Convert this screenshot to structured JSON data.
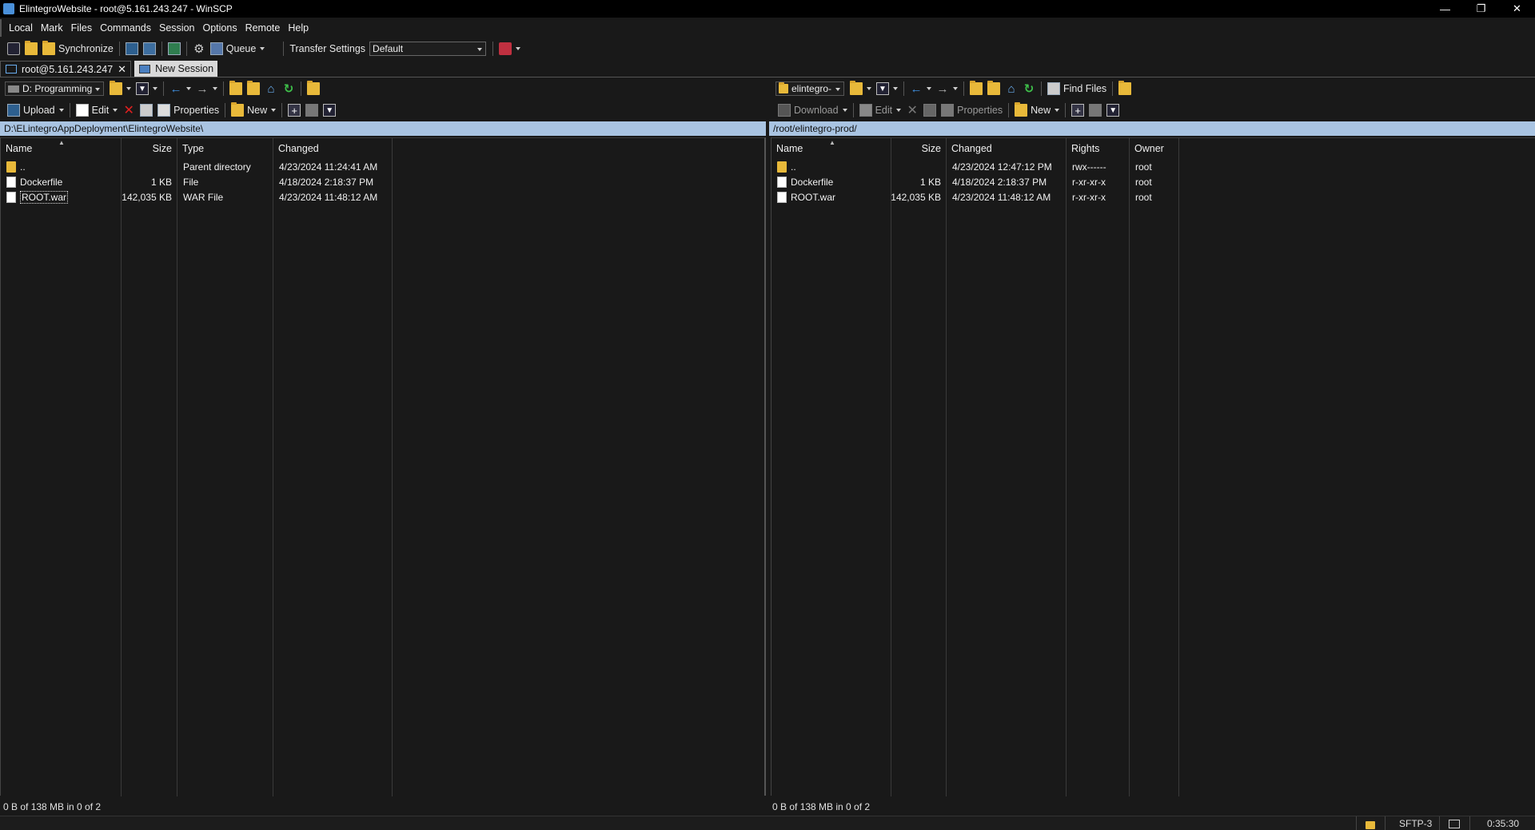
{
  "window": {
    "title": "ElintegroWebsite - root@5.161.243.247 - WinSCP",
    "minimize": "—",
    "restore": "❐",
    "close": "✕"
  },
  "menu": [
    "Local",
    "Mark",
    "Files",
    "Commands",
    "Session",
    "Options",
    "Remote",
    "Help"
  ],
  "toolbar": {
    "synchronize": "Synchronize",
    "queue": "Queue",
    "transfer_settings_label": "Transfer Settings",
    "transfer_settings_value": "Default"
  },
  "tabs": [
    {
      "label": "root@5.161.243.247",
      "close": "✕"
    },
    {
      "label": "New Session"
    }
  ],
  "local": {
    "drive": "D: Programming",
    "upload": "Upload",
    "edit": "Edit",
    "properties": "Properties",
    "new": "New",
    "path": "D:\\ELintegroAppDeployment\\ElintegroWebsite\\",
    "columns": {
      "name": "Name",
      "size": "Size",
      "type": "Type",
      "changed": "Changed"
    },
    "files": [
      {
        "name": "..",
        "size": "",
        "type": "Parent directory",
        "changed": "4/23/2024  11:24:41 AM"
      },
      {
        "name": "Dockerfile",
        "size": "1 KB",
        "type": "File",
        "changed": "4/18/2024  2:18:37 PM"
      },
      {
        "name": "ROOT.war",
        "size": "142,035 KB",
        "type": "WAR File",
        "changed": "4/23/2024  11:48:12 AM"
      }
    ],
    "status": "0 B of 138 MB in 0 of 2"
  },
  "remote": {
    "folder": "elintegro-",
    "find_files": "Find Files",
    "download": "Download",
    "edit": "Edit",
    "properties": "Properties",
    "new": "New",
    "path": "/root/elintegro-prod/",
    "columns": {
      "name": "Name",
      "size": "Size",
      "changed": "Changed",
      "rights": "Rights",
      "owner": "Owner"
    },
    "files": [
      {
        "name": "..",
        "size": "",
        "changed": "4/23/2024 12:47:12 PM",
        "rights": "rwx------",
        "owner": "root"
      },
      {
        "name": "Dockerfile",
        "size": "1 KB",
        "changed": "4/18/2024 2:18:37 PM",
        "rights": "r-xr-xr-x",
        "owner": "root"
      },
      {
        "name": "ROOT.war",
        "size": "142,035 KB",
        "changed": "4/23/2024 11:48:12 AM",
        "rights": "r-xr-xr-x",
        "owner": "root"
      }
    ],
    "status": "0 B of 138 MB in 0 of 2"
  },
  "statusbar": {
    "protocol": "SFTP-3",
    "elapsed": "0:35:30"
  }
}
